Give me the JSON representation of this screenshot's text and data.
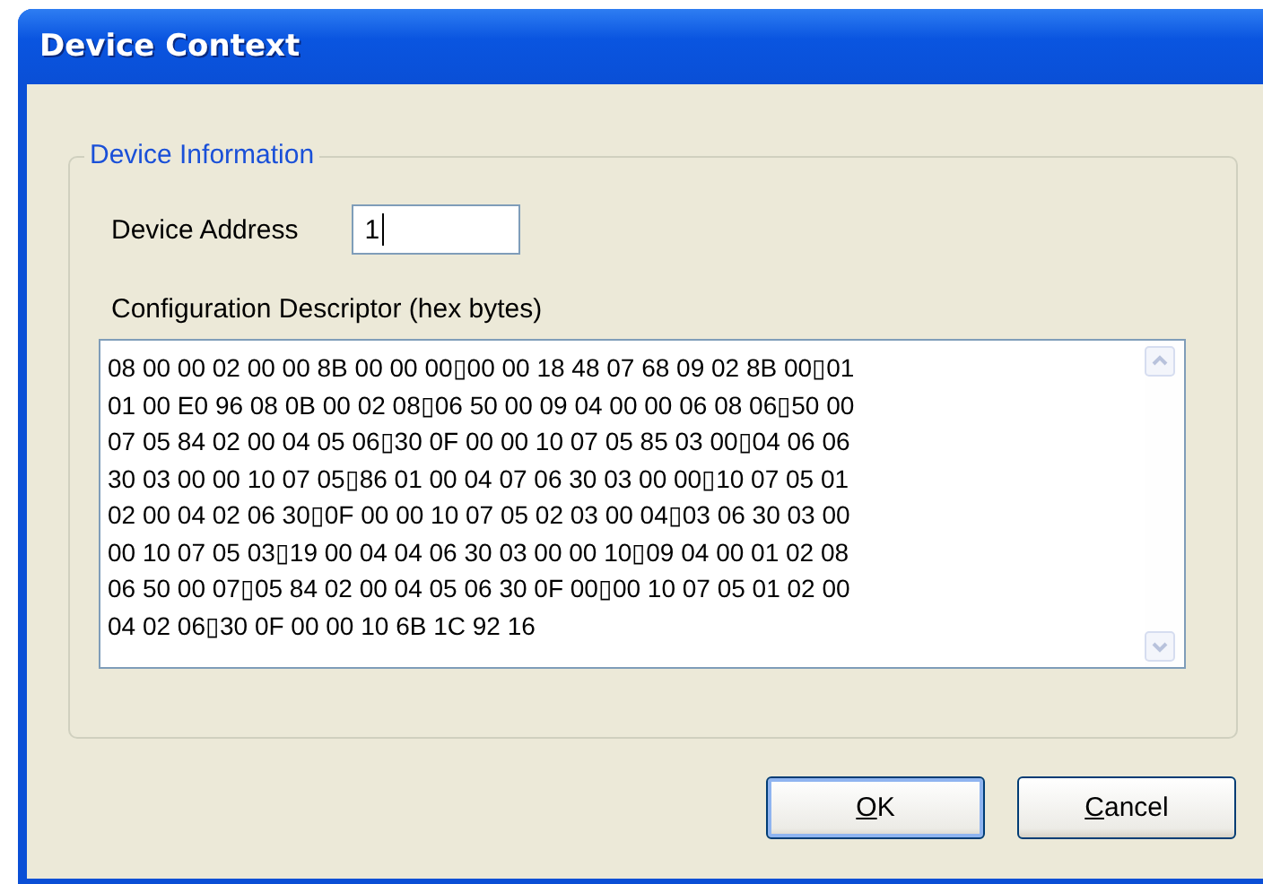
{
  "window": {
    "title": "Device Context"
  },
  "group": {
    "legend": "Device Information",
    "address": {
      "label": "Device Address",
      "value": "1"
    },
    "descriptor": {
      "label": "Configuration Descriptor (hex bytes)",
      "lines": [
        "08 00 00 02 00 00 8B 00 00 00▯00 00 18 48 07 68 09 02 8B 00▯01",
        "01 00 E0 96 08 0B 00 02 08▯06 50 00 09 04 00 00 06 08 06▯50 00",
        "07 05 84 02 00 04 05 06▯30 0F 00 00 10 07 05 85 03 00▯04 06 06",
        "30 03 00 00 10 07 05▯86 01 00 04 07 06 30 03 00 00▯10 07 05 01",
        "02 00 04 02 06 30▯0F 00 00 10 07 05 02 03 00 04▯03 06 30 03 00",
        "00 10 07 05 03▯19 00 04 04 06 30 03 00 00 10▯09 04 00 01 02 08",
        "06 50 00 07▯05 84 02 00 04 05 06 30 0F 00▯00 10 07 05 01 02 00",
        "04 02 06▯30 0F 00 00 10 6B 1C 92 16"
      ]
    }
  },
  "buttons": [
    {
      "label": "OK",
      "kind": "default"
    },
    {
      "label": "Cancel",
      "kind": "normal"
    }
  ]
}
